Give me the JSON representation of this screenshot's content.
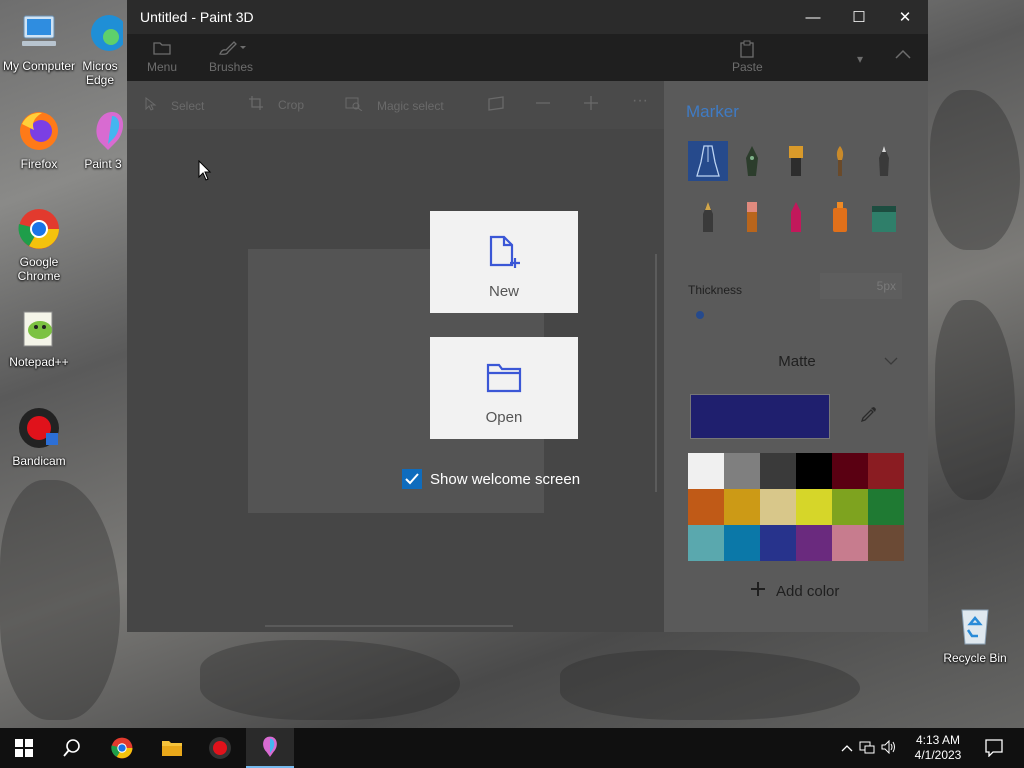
{
  "desktop": {
    "icons": [
      {
        "label_line1": "My Computer",
        "label_line2": ""
      },
      {
        "label_line1": "Micros",
        "label_line2": "Edge"
      },
      {
        "label_line1": "Firefox",
        "label_line2": ""
      },
      {
        "label_line1": "Paint 3",
        "label_line2": ""
      },
      {
        "label_line1": "Google",
        "label_line2": "Chrome"
      },
      {
        "label_line1": "Notepad++",
        "label_line2": ""
      },
      {
        "label_line1": "Bandicam",
        "label_line2": ""
      },
      {
        "label_line1": "Recycle Bin",
        "label_line2": ""
      }
    ]
  },
  "window": {
    "title": "Untitled - Paint 3D",
    "controls": {
      "minimize": "—",
      "maximize": "☐",
      "close": "✕"
    }
  },
  "ribbon": {
    "menu_label": "Menu",
    "brushes_label": "Brushes",
    "paste_label": "Paste"
  },
  "toolbar": {
    "select_label": "Select",
    "crop_label": "Crop",
    "magic_select_label": "Magic select"
  },
  "side_panel": {
    "title": "Marker",
    "thickness_label": "Thickness",
    "thickness_value": "5px",
    "finish": "Matte",
    "current_color": "#1f1f6e",
    "palette": [
      "#f0f0f0",
      "#7f7f7f",
      "#3a3a3a",
      "#000000",
      "#5a0012",
      "#8a1c22",
      "#c05a17",
      "#cc9a16",
      "#d8c78a",
      "#d6d629",
      "#7ea31f",
      "#1f7a33",
      "#5aa8ae",
      "#0b78a8",
      "#27338c",
      "#6a2a7e",
      "#c77c8e",
      "#6b4a35"
    ],
    "add_color_label": "Add color"
  },
  "welcome": {
    "new_label": "New",
    "open_label": "Open",
    "show_welcome_label": "Show welcome screen",
    "show_welcome_checked": true
  },
  "taskbar": {
    "time": "4:13 AM",
    "date": "4/1/2023"
  }
}
